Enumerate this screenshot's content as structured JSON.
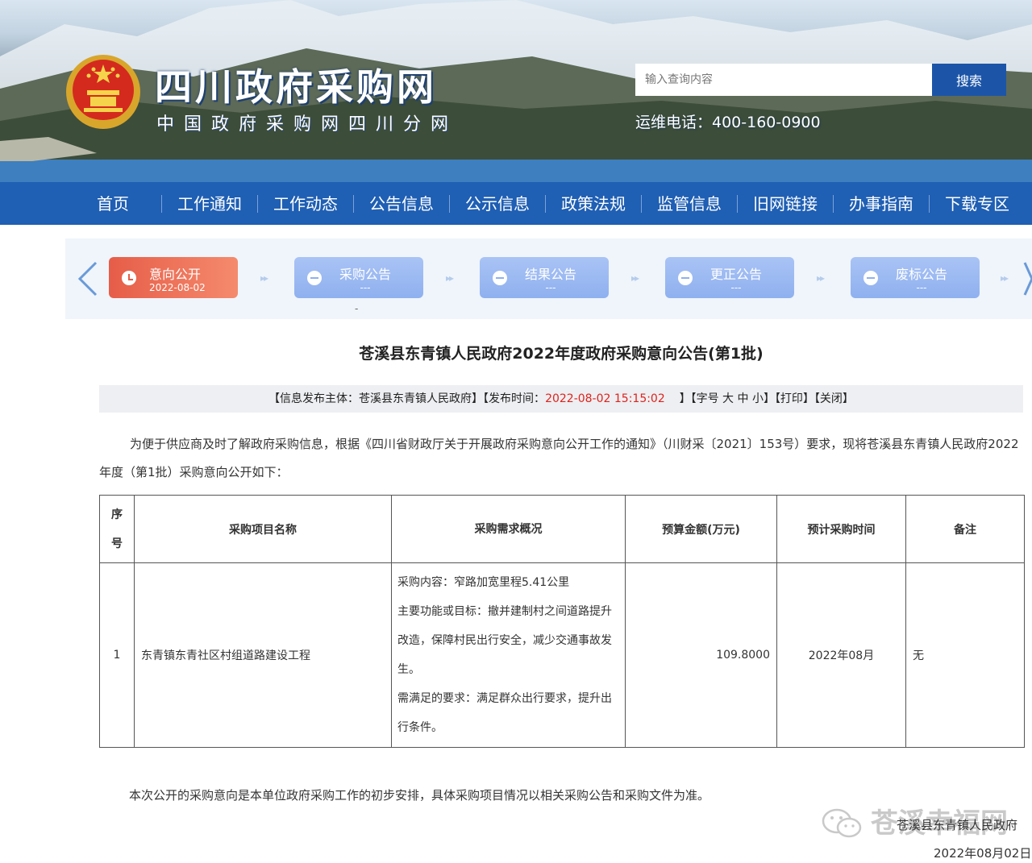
{
  "header": {
    "site_title": "四川政府采购网",
    "site_subtitle": "中国政府采购网四川分网",
    "search_placeholder": "输入查询内容",
    "search_button": "搜索",
    "hotline": "运维电话：400-160-0900"
  },
  "nav": {
    "items": [
      "首页",
      "工作通知",
      "工作动态",
      "公告信息",
      "公示信息",
      "政策法规",
      "监管信息",
      "旧网链接",
      "办事指南",
      "下载专区"
    ]
  },
  "process": {
    "steps": [
      {
        "label": "意向公开",
        "sub": "2022-08-02"
      },
      {
        "label": "采购公告",
        "sub": "---"
      },
      {
        "label": "结果公告",
        "sub": "---"
      },
      {
        "label": "更正公告",
        "sub": "---"
      },
      {
        "label": "废标公告",
        "sub": "---"
      }
    ],
    "below_mark": "-"
  },
  "article": {
    "title": "苍溪县东青镇人民政府2022年度政府采购意向公告(第1批)",
    "meta": {
      "publisher_prefix": "【信息发布主体：苍溪县东青镇人民政府】【发布时间：",
      "publish_time": "2022-08-02 15:15:02",
      "time_close": "】",
      "font_size_label": "【字号",
      "size_large": "大",
      "size_medium": "中",
      "size_small": "小",
      "font_close": "】",
      "print": "【打印】",
      "close": "【关闭】"
    },
    "paragraph": "为便于供应商及时了解政府采购信息，根据《四川省财政厅关于开展政府采购意向公开工作的通知》（川财采〔2021〕153号）要求，现将苍溪县东青镇人民政府2022年度（第1批）采购意向公开如下：",
    "table": {
      "headers": {
        "seq_line1": "序",
        "seq_line2": "号",
        "name": "采购项目名称",
        "need": "采购需求概况",
        "budget": "预算金额(万元)",
        "time": "预计采购时间",
        "note": "备注"
      },
      "row": {
        "seq": "1",
        "name": "东青镇东青社区村组道路建设工程",
        "need_content": "采购内容：窄路加宽里程5.41公里",
        "need_goal": "主要功能或目标：撤并建制村之间道路提升改造，保障村民出行安全，减少交通事故发生。",
        "need_require": "需满足的要求：满足群众出行要求，提升出行条件。",
        "budget": "109.8000",
        "time": "2022年08月",
        "note": "无"
      }
    },
    "footnote": "本次公开的采购意向是本单位政府采购工作的初步安排，具体采购项目情况以相关采购公告和采购文件为准。",
    "signer": "苍溪县东青镇人民政府",
    "sign_date": "2022年08月02日",
    "watermark": "苍溪幸福网"
  }
}
